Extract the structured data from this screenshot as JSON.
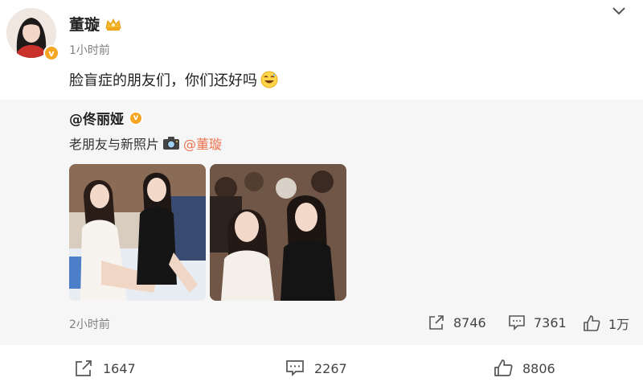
{
  "post": {
    "author_name": "董璇",
    "time": "1小时前",
    "text": "脸盲症的朋友们，你们还好吗",
    "verified_mark": "v",
    "icons": {
      "crown": "crown-badge-icon",
      "emoji": "grin-sweat-emoji-icon",
      "menu": "chevron-down-icon"
    }
  },
  "repost": {
    "author": "@佟丽娅",
    "verified_mark": "v",
    "text": "老朋友与新照片",
    "mention": "@董璇",
    "time": "2小时前",
    "photos": [
      {
        "name": "photo-white-dress-black-dress-seated"
      },
      {
        "name": "photo-two-women-closeup-audience"
      }
    ],
    "actions": {
      "share_count": "8746",
      "comment_count": "7361",
      "like_count": "1万"
    }
  },
  "footer": {
    "share_count": "1647",
    "comment_count": "2267",
    "like_count": "8806"
  },
  "colors": {
    "accent_orange": "#eb7350",
    "badge_gold": "#f5a623",
    "card_bg": "#f6f6f6"
  }
}
